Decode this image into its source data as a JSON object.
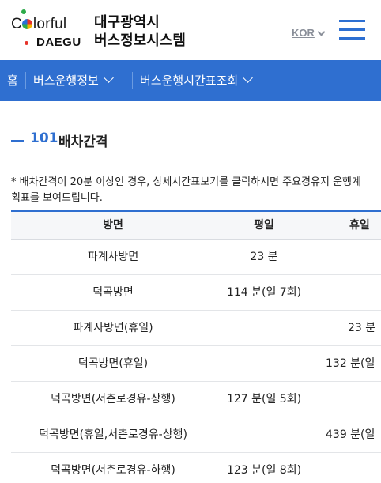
{
  "header": {
    "logo_text_colorful": "C lorful",
    "logo_text_daegu": "DAEGU",
    "site_title_line1": "대구광역시",
    "site_title_line2": "버스정보시스템",
    "language": "KOR"
  },
  "nav": {
    "home": "홈",
    "item1": "버스운행정보",
    "item2": "버스운행시간표조회"
  },
  "section": {
    "route": "101",
    "title": "배차간격"
  },
  "notice": "* 배차간격이 20분 이상인 경우, 상세시간표보기를 클릭하시면 주요경유지 운행계획표를 보여드립니다.",
  "table": {
    "headers": {
      "direction": "방면",
      "weekday": "평일",
      "holiday": "휴일"
    },
    "rows": [
      {
        "direction": "파계사방면",
        "weekday": "23 분",
        "holiday": ""
      },
      {
        "direction": "덕곡방면",
        "weekday": "114 분(일 7회)",
        "holiday": ""
      },
      {
        "direction": "파계사방면(휴일)",
        "weekday": "",
        "holiday": "23 분"
      },
      {
        "direction": "덕곡방면(휴일)",
        "weekday": "",
        "holiday": "132 분(일"
      },
      {
        "direction": "덕곡방면(서촌로경유-상행)",
        "weekday": "127 분(일 5회)",
        "holiday": ""
      },
      {
        "direction": "덕곡방면(휴일,서촌로경유-상행)",
        "weekday": "",
        "holiday": "439 분(일"
      },
      {
        "direction": "덕곡방면(서촌로경유-하행)",
        "weekday": "123 분(일 8회)",
        "holiday": ""
      }
    ]
  },
  "colors": {
    "brand_blue": "#2f6fd0",
    "lang_gray": "#8a8f99"
  }
}
